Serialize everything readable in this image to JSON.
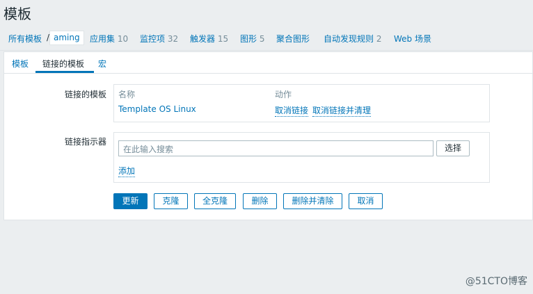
{
  "page": {
    "title": "模板"
  },
  "breadcrumb": {
    "all_templates": "所有模板",
    "separator": "/",
    "current": "aming",
    "items": [
      {
        "label": "应用集",
        "count": "10"
      },
      {
        "label": "监控项",
        "count": "32"
      },
      {
        "label": "触发器",
        "count": "15"
      },
      {
        "label": "图形",
        "count": "5"
      },
      {
        "label": "聚合图形",
        "count": ""
      },
      {
        "label": "自动发现规则",
        "count": "2"
      },
      {
        "label": "Web 场景",
        "count": ""
      }
    ]
  },
  "tabs": [
    {
      "label": "模板",
      "active": false
    },
    {
      "label": "链接的模板",
      "active": true
    },
    {
      "label": "宏",
      "active": false
    }
  ],
  "linked_templates": {
    "label": "链接的模板",
    "col_name": "名称",
    "col_action": "动作",
    "rows": [
      {
        "name": "Template OS Linux",
        "unlink": "取消链接",
        "unlink_clear": "取消链接并清理"
      }
    ]
  },
  "link_indicator": {
    "label": "链接指示器",
    "search_placeholder": "在此输入搜索",
    "select_button": "选择",
    "add_link": "添加"
  },
  "actions": {
    "update": "更新",
    "clone": "克隆",
    "full_clone": "全克隆",
    "delete": "删除",
    "delete_clear": "删除并清除",
    "cancel": "取消"
  },
  "watermark": "@51CTO博客",
  "colors": {
    "link": "#0275b8",
    "primary": "#0275b8",
    "background": "#ebeef0",
    "text": "#1f2c33",
    "muted": "#768d99"
  }
}
